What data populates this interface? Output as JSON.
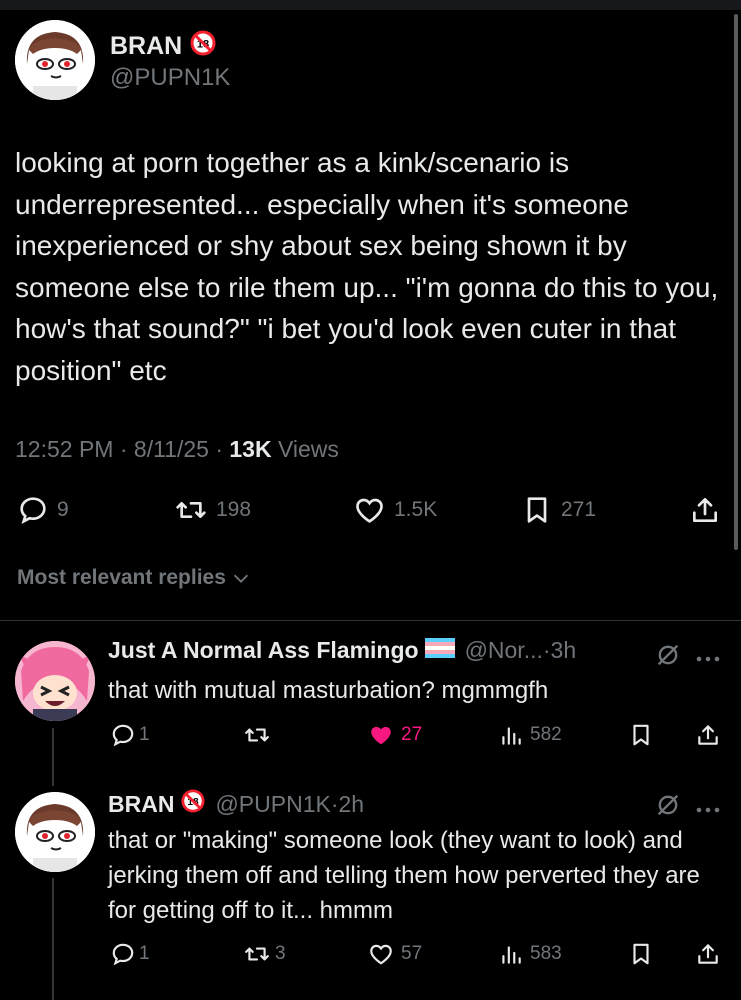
{
  "main_post": {
    "display_name": "BRAN",
    "handle": "@PUPN1K",
    "text": "looking at porn together as a kink/scenario is underrepresented... especially when it's someone inexperienced or shy about sex being shown it by someone else to rile them up... \"i'm gonna do this to you, how's that sound?\" \"i bet you'd look even cuter in that position\" etc",
    "time": "12:52 PM",
    "date": "8/11/25",
    "views_count": "13K",
    "views_label": "Views",
    "replies": "9",
    "reposts": "198",
    "likes": "1.5K",
    "bookmarks": "271"
  },
  "replies_header": "Most relevant replies",
  "replies": [
    {
      "display_name": "Just A Normal Ass Flamingo",
      "handle": "@Nor...",
      "age": "3h",
      "text": "that with mutual masturbation? mgmmgfh",
      "replies": "1",
      "reposts": "",
      "likes": "27",
      "views": "582",
      "liked": true
    },
    {
      "display_name": "BRAN",
      "handle": "@PUPN1K",
      "age": "2h",
      "text": "that or \"making\" someone look (they want to look) and jerking them off and telling them how perverted they are for getting off to it... hmmm",
      "replies": "1",
      "reposts": "3",
      "likes": "57",
      "views": "583",
      "liked": false
    }
  ],
  "colors": {
    "background": "#000000",
    "text": "#e7e9ea",
    "muted": "#71767b",
    "like_active": "#f91880",
    "badge_red": "#f4212e"
  }
}
